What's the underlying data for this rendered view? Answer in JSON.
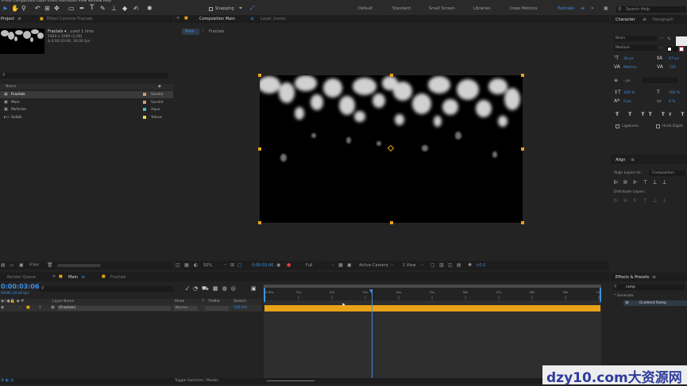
{
  "menu": {
    "items": [
      "e",
      "Edit",
      "Composition",
      "Layer",
      "Effect",
      "Animation",
      "View",
      "Window",
      "Help"
    ]
  },
  "toolbar": {
    "snapping": "Snapping"
  },
  "workspaces": [
    "Default",
    "Standard",
    "Small Screen",
    "Libraries",
    "Dope Motions",
    "Tutorials"
  ],
  "workspace_active": "Tutorials",
  "search_help": "Search Help",
  "project": {
    "tab": "Project",
    "effect_controls": "Effect Controls Fractals",
    "item_name": "Fractals",
    "item_used": ", used 1 time",
    "item_size": "1920 x 1080 (1.00)",
    "item_duration": "Δ 0:00:10:00, 30.00 fps",
    "col_name": "Name",
    "items": [
      {
        "name": "Fractals",
        "label": "Sandst",
        "color": "#c8a46e"
      },
      {
        "name": "Main",
        "label": "Sandst",
        "color": "#c8a46e"
      },
      {
        "name": "Particles",
        "label": "Aqua",
        "color": "#4bb8b8"
      },
      {
        "name": "Solids",
        "label": "Yellow",
        "color": "#e5d84a"
      }
    ],
    "bpc": "8 bpc"
  },
  "composition": {
    "tab": "Composition Main",
    "layer_tab": "Layer (none)",
    "breadcrumb_main": "Main",
    "breadcrumb_fractals": "Fractals",
    "zoom": "50%",
    "timecode": "0:00:03:06",
    "resolution": "Full",
    "camera": "Active Camera",
    "view": "1 View",
    "exposure": "+0.0"
  },
  "character": {
    "tab": "Character",
    "paragraph_tab": "Paragraph",
    "font": "Bison",
    "style": "Medium",
    "size": "34 px",
    "leading": "67 px",
    "kerning": "Metrics",
    "tracking": "720",
    "stroke": "- px",
    "vscale": "100 %",
    "hscale": "100 %",
    "baseline": "0 px",
    "tsume": "0 %",
    "ligatures": "Ligatures",
    "hindi": "Hindi Digits"
  },
  "align": {
    "tab": "Align",
    "align_to_label": "Align Layers to:",
    "align_to_value": "Composition",
    "distribute": "Distribute Layers:"
  },
  "effects": {
    "tab": "Effects & Presets",
    "search": "ramp",
    "category": "* Generate",
    "result": "Gradient Ramp"
  },
  "timeline": {
    "render_queue": "Render Queue",
    "tab_main": "Main",
    "tab_fractals": "Fractals",
    "timecode": "0:00:03:06",
    "frame_info": "00096 (30.00 fps)",
    "col_layer_name": "Layer Name",
    "col_mode": "Mode",
    "col_t": "T",
    "col_trkmat": "TrkMat",
    "col_stretch": "Stretch",
    "layer_num": "1",
    "layer_name": "[Fractals]",
    "layer_mode": "Norma",
    "layer_stretch": "100.0%",
    "ruler": [
      "0:00s",
      "01s",
      "02s",
      "03s",
      "04s",
      "05s",
      "06s",
      "07s",
      "08s",
      "09s",
      "10s"
    ],
    "toggle": "Toggle Switches / Modes"
  },
  "watermark": "dzy10.com大资源网"
}
